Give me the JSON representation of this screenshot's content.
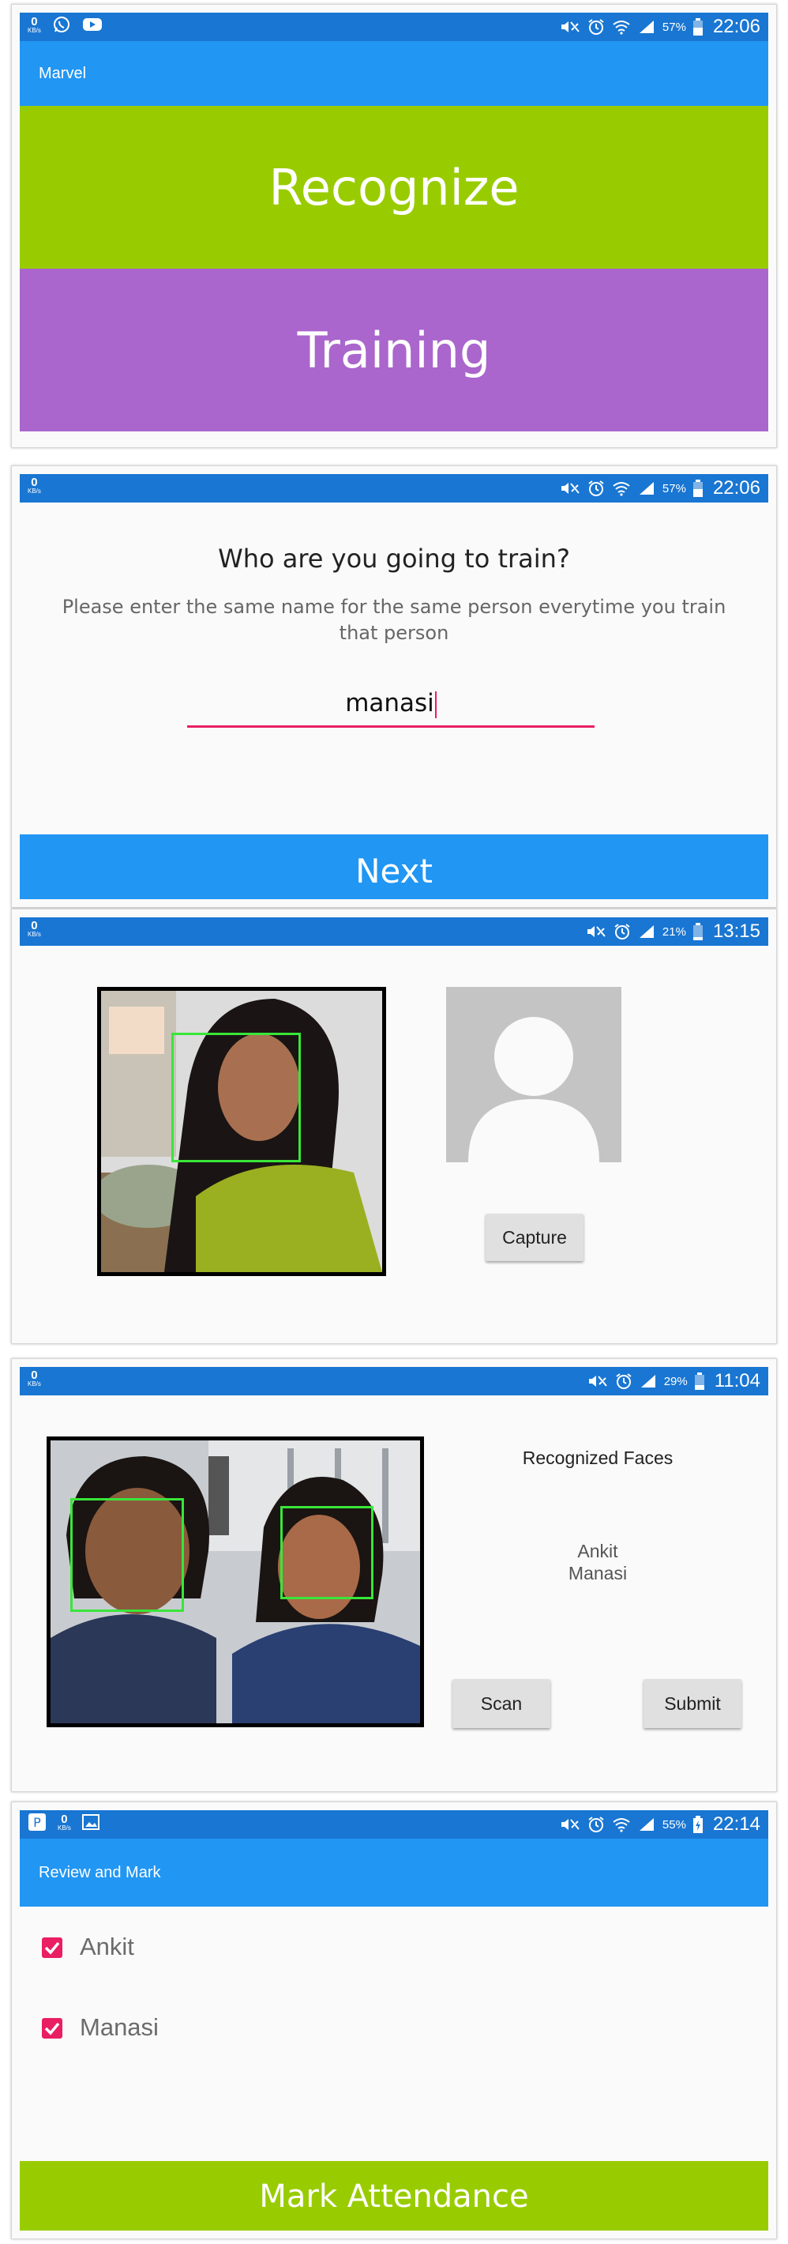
{
  "status_bars": [
    {
      "kb_value": "0",
      "kb_unit": "KB/s",
      "battery": "57%",
      "time": "22:06",
      "left_icons": [
        "whatsapp-icon",
        "youtube-icon"
      ]
    },
    {
      "kb_value": "0",
      "kb_unit": "KB/s",
      "battery": "57%",
      "time": "22:06"
    },
    {
      "kb_value": "0",
      "kb_unit": "KB/s",
      "battery": "21%",
      "time": "13:15"
    },
    {
      "kb_value": "0",
      "kb_unit": "KB/s",
      "battery": "29%",
      "time": "11:04"
    },
    {
      "kb_value": "0",
      "kb_unit": "KB/s",
      "battery": "55%",
      "time": "22:14",
      "left_icons": [
        "p-badge-icon",
        "gallery-icon"
      ]
    }
  ],
  "home": {
    "app_title": "Marvel",
    "recognize_label": "Recognize",
    "training_label": "Training",
    "colors": {
      "recognize": "#99cc00",
      "training": "#aa66cc"
    }
  },
  "train_name": {
    "heading": "Who are you going to train?",
    "instruction": "Please enter the same name for the same person everytime you train that person",
    "name_value": "manasi",
    "next_label": "Next"
  },
  "capture": {
    "capture_label": "Capture"
  },
  "recognize": {
    "heading": "Recognized Faces",
    "faces": [
      "Ankit",
      "Manasi"
    ],
    "scan_label": "Scan",
    "submit_label": "Submit"
  },
  "review": {
    "title": "Review and Mark",
    "items": [
      {
        "label": "Ankit",
        "checked": true
      },
      {
        "label": "Manasi",
        "checked": true
      }
    ],
    "mark_label": "Mark Attendance"
  }
}
